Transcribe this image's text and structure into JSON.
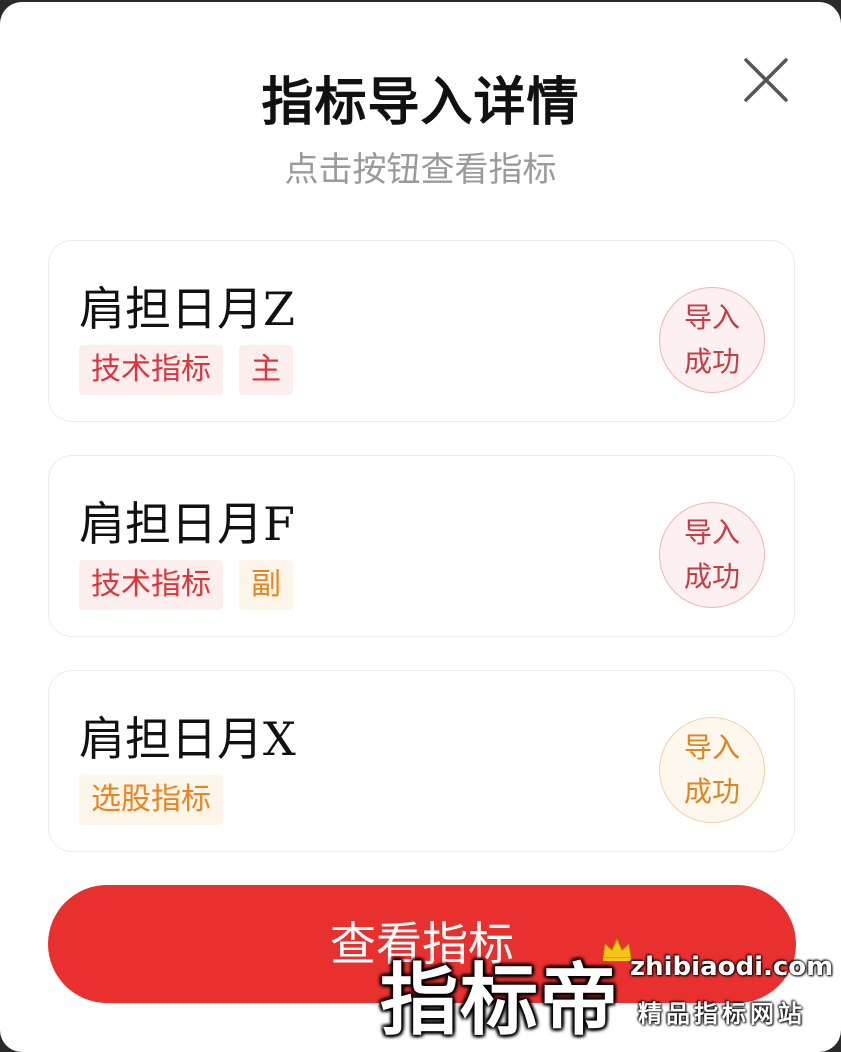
{
  "header": {
    "title": "指标导入详情",
    "subtitle": "点击按钮查看指标"
  },
  "cards": [
    {
      "name": "肩担日月Z",
      "tags": [
        {
          "label": "技术指标",
          "color": "red"
        },
        {
          "label": "主",
          "color": "red"
        }
      ],
      "status": {
        "line1": "导入",
        "line2": "成功",
        "color": "red"
      }
    },
    {
      "name": "肩担日月F",
      "tags": [
        {
          "label": "技术指标",
          "color": "red"
        },
        {
          "label": "副",
          "color": "orange"
        }
      ],
      "status": {
        "line1": "导入",
        "line2": "成功",
        "color": "red"
      }
    },
    {
      "name": "肩担日月X",
      "tags": [
        {
          "label": "选股指标",
          "color": "orange"
        }
      ],
      "status": {
        "line1": "导入",
        "line2": "成功",
        "color": "orange"
      }
    }
  ],
  "action": {
    "view_label": "查看指标"
  },
  "watermark": {
    "brand": "指标帝",
    "url": "zhibiaodi.com",
    "tagline": "精品指标网站"
  },
  "colors": {
    "accent": "#e8302f",
    "tag_red": "#d9363e",
    "tag_orange": "#e8851e"
  },
  "icons": {
    "close": "close-icon",
    "crown": "crown-icon"
  }
}
